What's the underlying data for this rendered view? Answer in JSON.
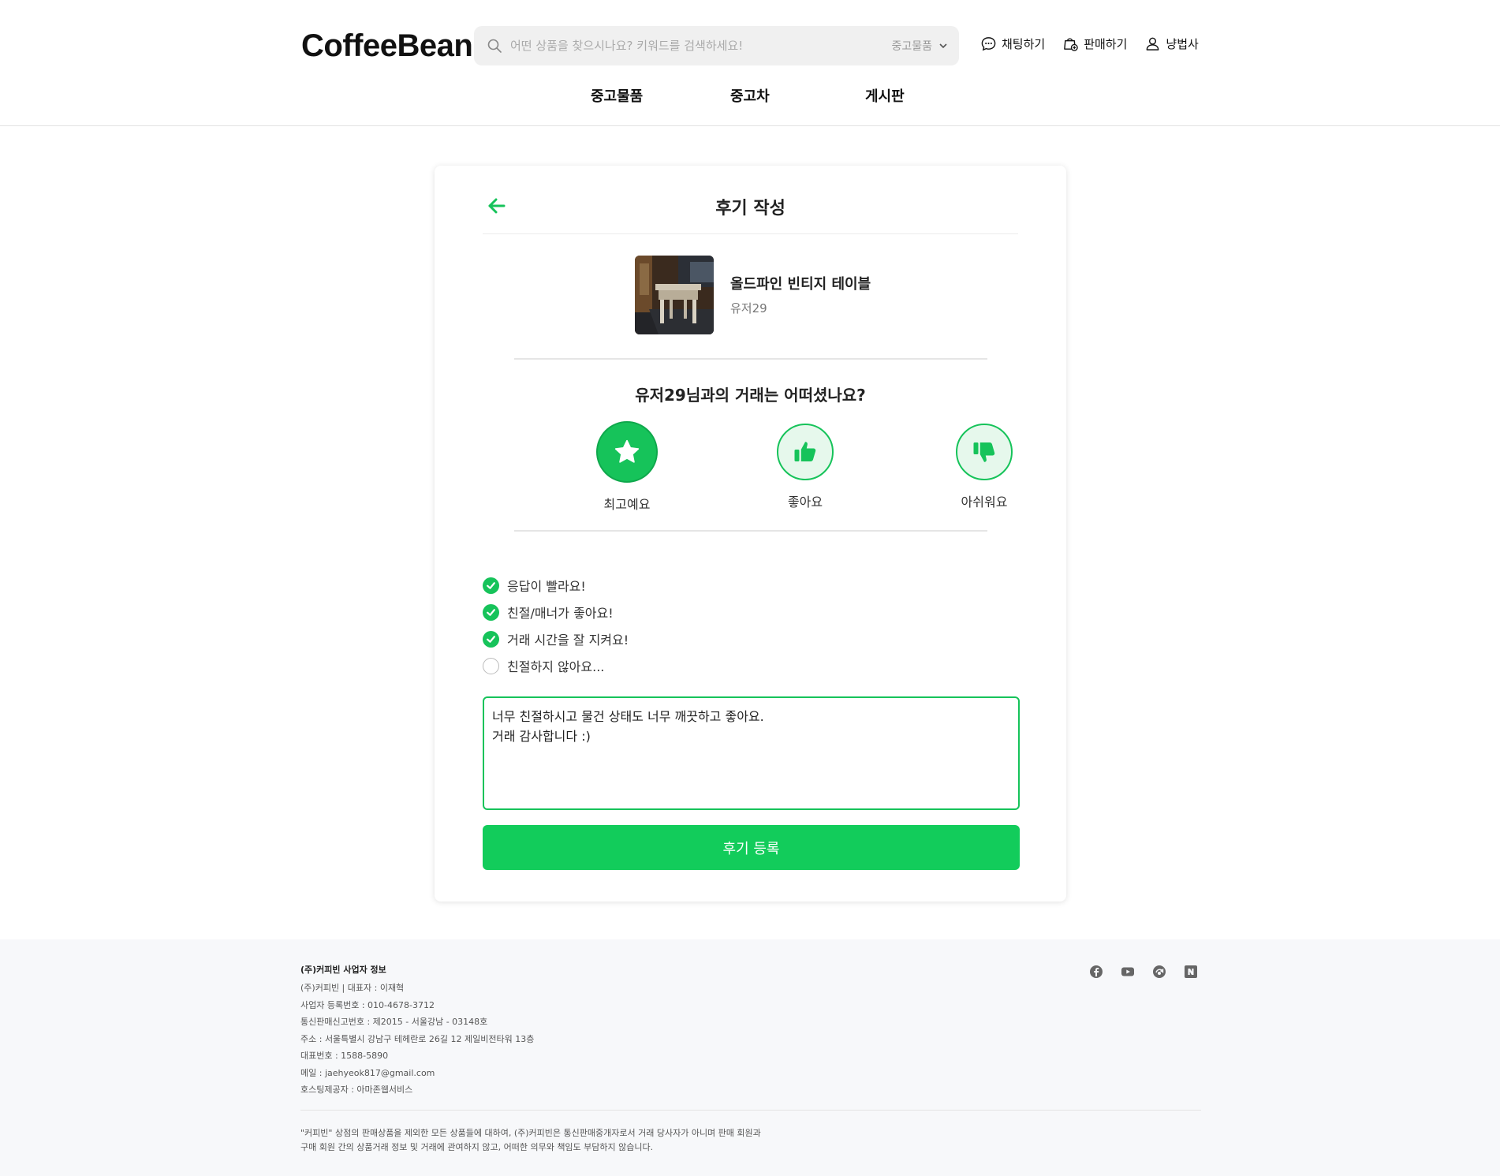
{
  "header": {
    "logo": "CoffeeBean",
    "search_placeholder": "어떤 상품을 찾으시나요? 키워드를 검색하세요!",
    "search_category": "중고물품",
    "links": [
      {
        "label": "채팅하기",
        "icon": "chat-icon"
      },
      {
        "label": "판매하기",
        "icon": "sell-bag-icon"
      },
      {
        "label": "냥법사",
        "icon": "user-icon"
      }
    ],
    "nav": [
      "중고물품",
      "중고차",
      "게시판"
    ]
  },
  "review_page": {
    "title": "후기 작성",
    "product": {
      "name": "올드파인 빈티지 테이블",
      "seller": "유저29"
    },
    "question": "유저29님과의 거래는 어떠셨나요?",
    "ratings": [
      {
        "label": "최고예요",
        "icon": "star-icon",
        "selected": true
      },
      {
        "label": "좋아요",
        "icon": "thumbs-up-icon",
        "selected": false
      },
      {
        "label": "아쉬워요",
        "icon": "thumbs-down-icon",
        "selected": false
      }
    ],
    "checklist": [
      {
        "label": "응답이 빨라요!",
        "checked": true
      },
      {
        "label": "친절/매너가 좋아요!",
        "checked": true
      },
      {
        "label": "거래 시간을 잘 지켜요!",
        "checked": true
      },
      {
        "label": "친절하지 않아요...",
        "checked": false
      }
    ],
    "review_text": "너무 친절하시고 물건 상태도 너무 깨끗하고 좋아요.\n거래 감사합니다 :)",
    "submit_label": "후기 등록"
  },
  "footer": {
    "title": "(주)커피빈 사업자 정보",
    "lines": [
      "(주)커피빈 | 대표자 : 이재혁",
      "사업자 등록번호 : 010-4678-3712",
      "통신판매신고번호 : 제2015 - 서울강남 - 03148호",
      "주소 : 서울특별시 강남구 테헤란로 26길 12 제일비전타워 13층",
      "대표번호 : 1588-5890",
      "메일 : jaehyeok817@gmail.com",
      "호스팅제공자 : 아마존웹서비스"
    ],
    "notice_line1": "\"커피빈\" 상점의 판매상품을 제외한 모든 상품들에 대하여, (주)커피빈은 통신판매중개자로서 거래 당사자가 아니며 판매 회원과",
    "notice_line2": "구매 회원 간의 상품거래 정보 및 거래에 관여하지 않고, 어떠한 의무와 책임도 부담하지 않습니다.",
    "social": [
      "facebook-icon",
      "youtube-icon",
      "blog-icon",
      "naver-icon"
    ]
  },
  "colors": {
    "accent": "#12cc5b",
    "accent_light": "#e6f8ec"
  }
}
